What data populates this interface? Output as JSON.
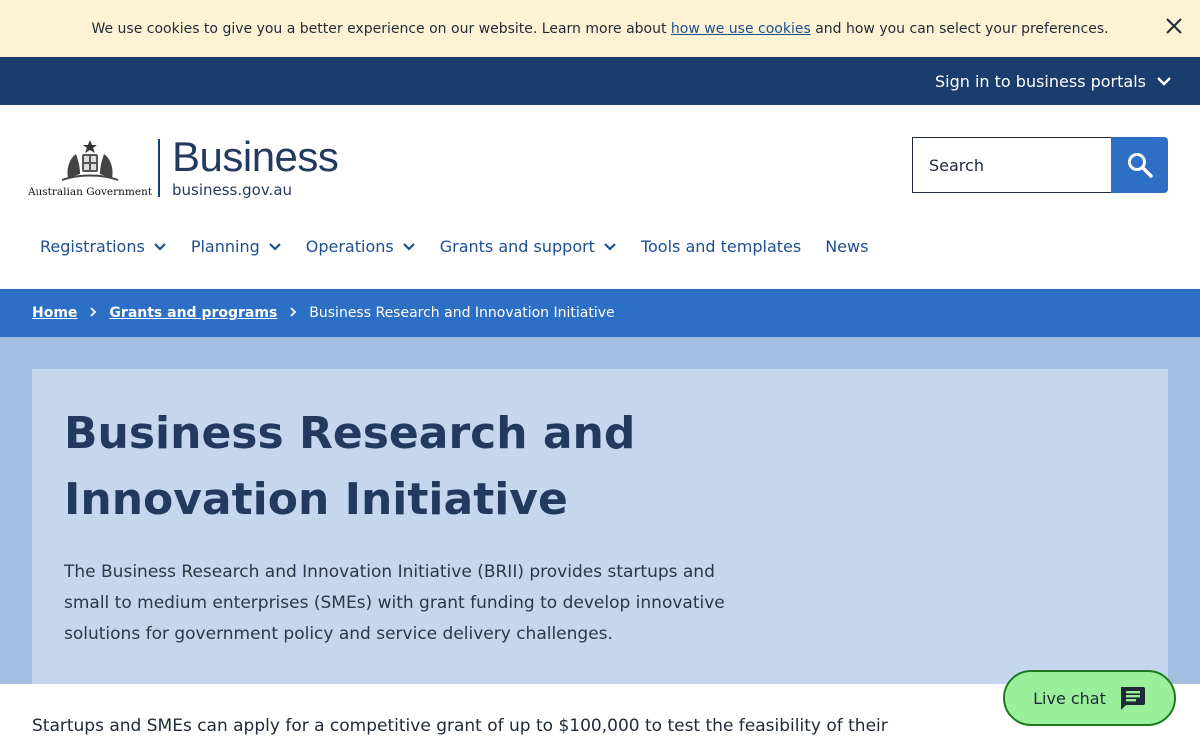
{
  "cookie_banner": {
    "text_before": "We use cookies to give you a better experience on our website. Learn more about ",
    "link_text": "how we use cookies",
    "text_after": " and how you can select your preferences."
  },
  "top_bar": {
    "portal_link": "Sign in to business portals"
  },
  "header": {
    "gov_label": "Australian Government",
    "brand_title": "Business",
    "brand_url": "business.gov.au",
    "search_placeholder": "Search"
  },
  "nav": {
    "items": [
      {
        "label": "Registrations",
        "dropdown": true
      },
      {
        "label": "Planning",
        "dropdown": true
      },
      {
        "label": "Operations",
        "dropdown": true
      },
      {
        "label": "Grants and support",
        "dropdown": true
      },
      {
        "label": "Tools and templates",
        "dropdown": false
      },
      {
        "label": "News",
        "dropdown": false
      }
    ]
  },
  "breadcrumb": {
    "home": "Home",
    "parent": "Grants and programs",
    "current": "Business Research and Innovation Initiative"
  },
  "hero": {
    "title": "Business Research and Innovation Initiative",
    "description": "The Business Research and Innovation Initiative (BRII) provides startups and small to medium enterprises (SMEs) with grant funding to develop innovative solutions for government policy and service delivery challenges."
  },
  "body": {
    "intro": "Startups and SMEs can apply for a competitive grant of up to $100,000 to test the feasibility of their"
  },
  "live_chat": {
    "label": "Live chat"
  },
  "colors": {
    "cookie_bg": "#fdf3d4",
    "top_bar": "#1b3d6d",
    "brand_blue": "#2c6fc4",
    "nav_text": "#1d4f91",
    "hero_band": "#a3bde0",
    "hero_card": "#c5d6ee",
    "chat_green": "#9af09a"
  }
}
